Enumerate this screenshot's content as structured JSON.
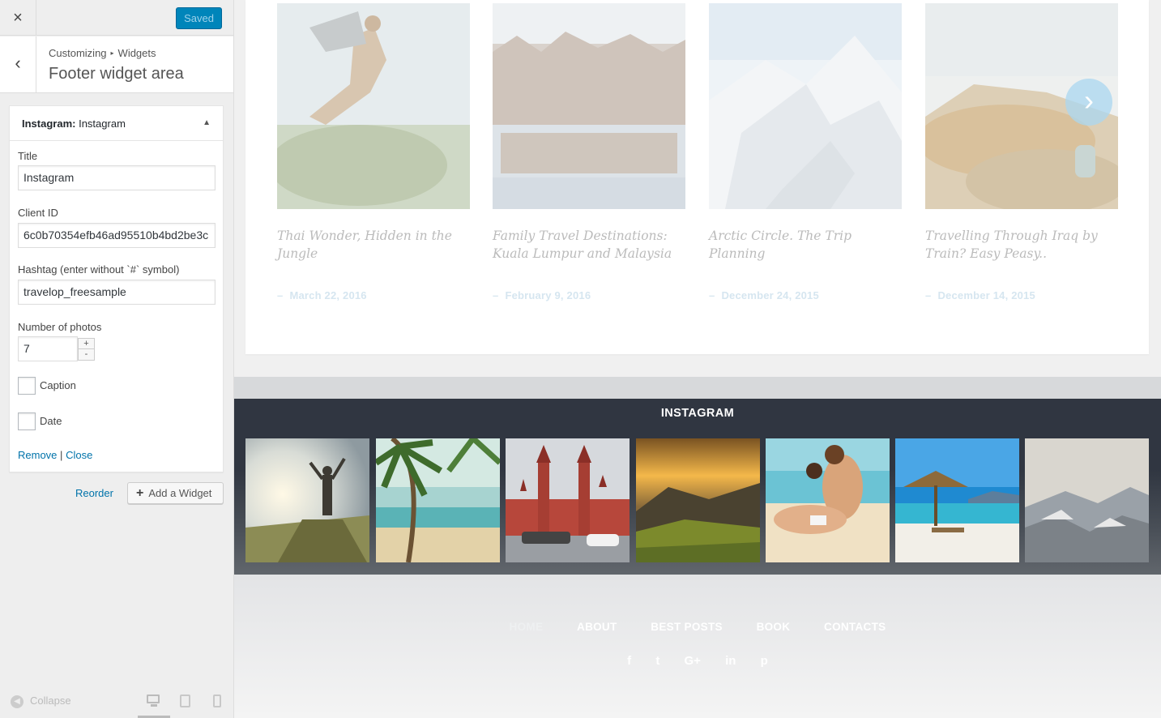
{
  "customizer": {
    "close_icon": "×",
    "saved_label": "Saved",
    "back_icon": "‹",
    "breadcrumb": {
      "parent": "Customizing",
      "sep": "▸",
      "current": "Widgets"
    },
    "section_title": "Footer widget area",
    "widget": {
      "type_label": "Instagram:",
      "name": "Instagram",
      "toggle_icon": "▲",
      "fields": {
        "title_label": "Title",
        "title_value": "Instagram",
        "client_id_label": "Client ID",
        "client_id_value": "6c0b70354efb46ad95510b4bd2be3c",
        "hashtag_label": "Hashtag (enter without `#` symbol)",
        "hashtag_value": "travelop_freesample",
        "photos_label": "Number of photos",
        "photos_value": "7",
        "spin_up": "+",
        "spin_down": "-",
        "caption_label": "Caption",
        "date_label": "Date"
      },
      "remove_label": "Remove",
      "actions_sep": "|",
      "close_label": "Close"
    },
    "reorder_label": "Reorder",
    "add_widget_icon": "+",
    "add_widget_label": "Add a Widget",
    "collapse_icon": "◀",
    "collapse_label": "Collapse",
    "accent": "#0085ba"
  },
  "preview": {
    "posts": [
      {
        "title": "Thai Wonder, Hidden in the Jungle",
        "date": "March 22, 2016"
      },
      {
        "title": "Family Travel Destinations: Kuala Lumpur and Malaysia",
        "date": "February 9, 2016"
      },
      {
        "title": "Arctic Circle. The Trip Planning",
        "date": "December 24, 2015"
      },
      {
        "title": "Travelling Through Iraq by Train? Easy Peasy..",
        "date": "December 14, 2015"
      }
    ],
    "date_dash": "–",
    "next_arrow": "›",
    "instagram_title": "INSTAGRAM",
    "footer_nav": [
      "HOME",
      "ABOUT",
      "BEST POSTS",
      "BOOK",
      "CONTACTS"
    ],
    "social_icons": [
      "f",
      "t",
      "G+",
      "in",
      "p"
    ]
  }
}
